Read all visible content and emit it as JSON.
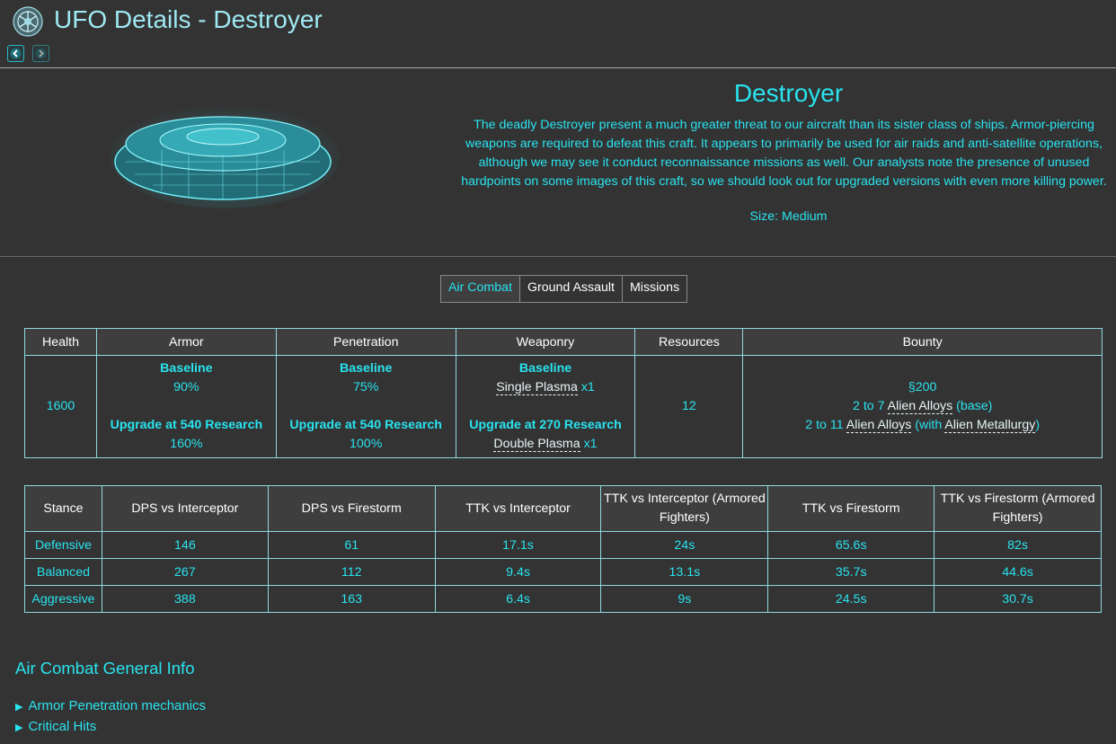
{
  "header": {
    "title": "UFO Details - Destroyer",
    "logo_icon": "xcom-emblem-icon",
    "prev_icon": "chevron-left-icon",
    "next_icon": "chevron-right-icon"
  },
  "ufo": {
    "name": "Destroyer",
    "description": "The deadly Destroyer present a much greater threat to our aircraft than its sister class of ships. Armor-piercing weapons are required to defeat this craft. It appears to primarily be used for air raids and anti-satellite operations, although we may see it conduct reconnaissance missions as well. Our analysts note the presence of unused hardpoints on some images of this craft, so we should look out for upgraded versions with even more killing power.",
    "size_label": "Size:",
    "size_value": "Medium",
    "image_icon": "ufo-wireframe-icon"
  },
  "tabs": [
    {
      "label": "Air Combat",
      "active": true
    },
    {
      "label": "Ground Assault",
      "active": false
    },
    {
      "label": "Missions",
      "active": false
    }
  ],
  "stats_table": {
    "headers": [
      "Health",
      "Armor",
      "Penetration",
      "Weaponry",
      "Resources",
      "Bounty"
    ],
    "health": "1600",
    "armor": {
      "baseline_label": "Baseline",
      "baseline_value": "90%",
      "upgrade_label": "Upgrade at 540 Research",
      "upgrade_value": "160%"
    },
    "penetration": {
      "baseline_label": "Baseline",
      "baseline_value": "75%",
      "upgrade_label": "Upgrade at 540 Research",
      "upgrade_value": "100%"
    },
    "weaponry": {
      "baseline_label": "Baseline",
      "baseline_weapon": "Single Plasma",
      "baseline_count": " x1",
      "upgrade_label": "Upgrade at 270 Research",
      "upgrade_weapon": "Double Plasma",
      "upgrade_count": " x1"
    },
    "resources": "12",
    "bounty": {
      "credits": "§200",
      "line2_prefix": "2 to 7 ",
      "line2_item": "Alien Alloys",
      "line2_suffix": " (base)",
      "line3_prefix": "2 to 11 ",
      "line3_item": "Alien Alloys",
      "line3_mid": " (with ",
      "line3_tech": "Alien Metallurgy",
      "line3_suffix": ")"
    }
  },
  "stance_table": {
    "headers": [
      "Stance",
      "DPS vs Interceptor",
      "DPS vs Firestorm",
      "TTK vs Interceptor",
      "TTK vs Interceptor (Armored Fighters)",
      "TTK vs Firestorm",
      "TTK vs Firestorm (Armored Fighters)"
    ],
    "rows": [
      [
        "Defensive",
        "146",
        "61",
        "17.1s",
        "24s",
        "65.6s",
        "82s"
      ],
      [
        "Balanced",
        "267",
        "112",
        "9.4s",
        "13.1s",
        "35.7s",
        "44.6s"
      ],
      [
        "Aggressive",
        "388",
        "163",
        "6.4s",
        "9s",
        "24.5s",
        "30.7s"
      ]
    ]
  },
  "general_info": {
    "heading": "Air Combat General Info",
    "items": [
      "Armor Penetration mechanics",
      "Critical Hits"
    ]
  },
  "colors": {
    "accent": "#29e3ef",
    "background": "#333333",
    "header_cell": "#3e3e3e"
  }
}
